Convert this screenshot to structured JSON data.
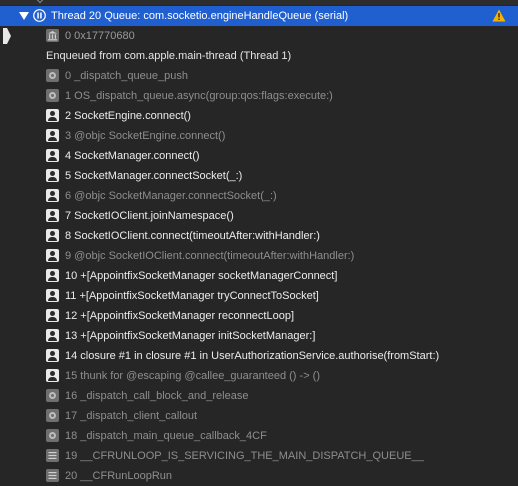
{
  "thread": {
    "title": "Thread 20 Queue: com.socketio.engineHandleQueue (serial)",
    "icons": {
      "disclosure": "disclosure-triangle-icon",
      "thread": "thread-icon",
      "warning": "warning-triangle-icon"
    },
    "colors": {
      "selected_bg": "#1f5fd0",
      "warning": "#f5b301"
    }
  },
  "first_frame": {
    "label": "0 0x17770680",
    "icon": "building-icon"
  },
  "enqueued_label": "Enqueued from com.apple.main-thread (Thread 1)",
  "frames": [
    {
      "label": "0 _dispatch_queue_push",
      "icon": "gear-icon",
      "type": "dim"
    },
    {
      "label": "1 OS_dispatch_queue.async(group:qos:flags:execute:)",
      "icon": "gear-icon",
      "type": "dim"
    },
    {
      "label": "2 SocketEngine.connect()",
      "icon": "user-icon",
      "type": "user"
    },
    {
      "label": "3 @objc SocketEngine.connect()",
      "icon": "user-icon",
      "type": "dim"
    },
    {
      "label": "4 SocketManager.connect()",
      "icon": "user-icon",
      "type": "user"
    },
    {
      "label": "5 SocketManager.connectSocket(_:)",
      "icon": "user-icon",
      "type": "user"
    },
    {
      "label": "6 @objc SocketManager.connectSocket(_:)",
      "icon": "user-icon",
      "type": "dim"
    },
    {
      "label": "7 SocketIOClient.joinNamespace()",
      "icon": "user-icon",
      "type": "user"
    },
    {
      "label": "8 SocketIOClient.connect(timeoutAfter:withHandler:)",
      "icon": "user-icon",
      "type": "user"
    },
    {
      "label": "9 @objc SocketIOClient.connect(timeoutAfter:withHandler:)",
      "icon": "user-icon",
      "type": "dim"
    },
    {
      "label": "10 +[AppointfixSocketManager socketManagerConnect]",
      "icon": "user-icon",
      "type": "user"
    },
    {
      "label": "11 +[AppointfixSocketManager tryConnectToSocket]",
      "icon": "user-icon",
      "type": "user"
    },
    {
      "label": "12 +[AppointfixSocketManager reconnectLoop]",
      "icon": "user-icon",
      "type": "user"
    },
    {
      "label": "13 +[AppointfixSocketManager initSocketManager:]",
      "icon": "user-icon",
      "type": "user"
    },
    {
      "label": "14 closure #1 in closure #1 in UserAuthorizationService.authorise(fromStart:)",
      "icon": "user-icon",
      "type": "user"
    },
    {
      "label": "15 thunk for @escaping @callee_guaranteed () -> ()",
      "icon": "user-icon",
      "type": "dim"
    },
    {
      "label": "16 _dispatch_call_block_and_release",
      "icon": "gear-icon",
      "type": "dim"
    },
    {
      "label": "17 _dispatch_client_callout",
      "icon": "gear-icon",
      "type": "dim"
    },
    {
      "label": "18 _dispatch_main_queue_callback_4CF",
      "icon": "gear-icon",
      "type": "dim"
    },
    {
      "label": "19 __CFRUNLOOP_IS_SERVICING_THE_MAIN_DISPATCH_QUEUE__",
      "icon": "lines-icon",
      "type": "dim"
    },
    {
      "label": "20 __CFRunLoopRun",
      "icon": "lines-icon",
      "type": "dim"
    }
  ]
}
